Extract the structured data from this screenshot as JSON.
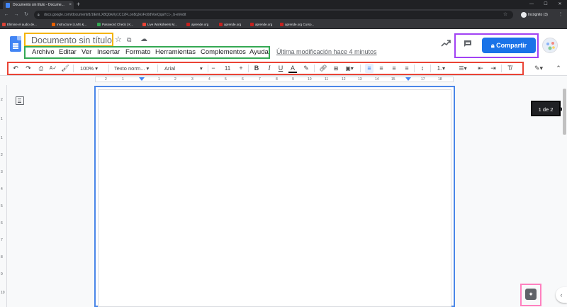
{
  "browser": {
    "tab_title": "Documento sin título - Docume...",
    "tab_close": "×",
    "new_tab": "+",
    "url": "docs.google.com/document/d/1lEmLX8Q0wXy1C12FLon8qJexFo0dVoeQqaYc1-_b-et/edit",
    "incognito_label": "Incógnito (3)",
    "bookmarks": [
      {
        "label": "Elimine el audio de...",
        "color": "#db4437"
      },
      {
        "label": "Instructure | LMS &...",
        "color": "#e66000"
      },
      {
        "label": "Password Check | K...",
        "color": "#34a853"
      },
      {
        "label": "Live Worksheets M...",
        "color": "#ea4335"
      },
      {
        "label": "aprende.org",
        "color": "#c5221f"
      },
      {
        "label": "aprende.org",
        "color": "#c5221f"
      },
      {
        "label": "aprende.org",
        "color": "#c5221f"
      },
      {
        "label": "aprende.org Curso...",
        "color": "#c5221f"
      }
    ]
  },
  "docs": {
    "title": "Documento sin título",
    "menu": [
      "Archivo",
      "Editar",
      "Ver",
      "Insertar",
      "Formato",
      "Herramientas",
      "Complementos",
      "Ayuda"
    ],
    "last_edit": "Última modificación hace 4 minutos",
    "share_label": "Compartir",
    "toolbar": {
      "zoom": "100%",
      "style": "Texto norm...",
      "font": "Arial",
      "font_size": "11"
    },
    "ruler_numbers": [
      "2",
      "1",
      "1",
      "2",
      "3",
      "4",
      "5",
      "6",
      "7",
      "8",
      "9",
      "10",
      "11",
      "12",
      "13",
      "14",
      "15",
      "16",
      "17",
      "18"
    ],
    "vruler_numbers": [
      "2",
      "1",
      "1",
      "2",
      "3",
      "4",
      "5",
      "6",
      "7",
      "8",
      "9",
      "10"
    ],
    "page_indicator": "1 de 2",
    "accent_color": "#1a73e8"
  }
}
